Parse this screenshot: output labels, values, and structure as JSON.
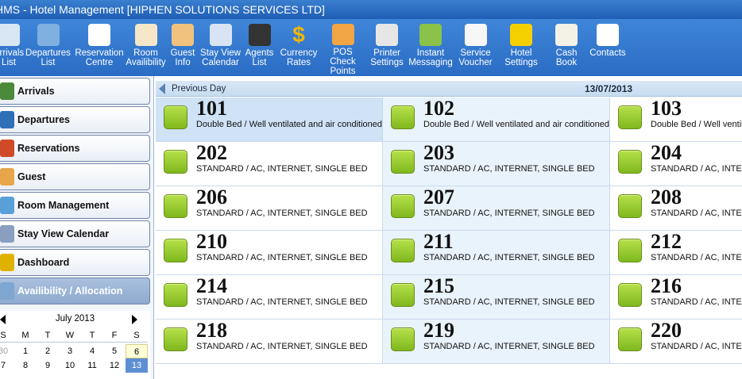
{
  "window": {
    "title": "HMS - Hotel Management [HIPHEN SOLUTIONS SERVICES LTD]"
  },
  "toolbar": {
    "items": [
      {
        "label": "Arrivals\nList",
        "icon": "arrivals-icon",
        "color": "#d9e6f3"
      },
      {
        "label": "Departures\nList",
        "icon": "departures-icon",
        "color": "#7fb0e0"
      },
      {
        "label": "Reservation\nCentre",
        "icon": "reservation-icon",
        "color": "#ffffff"
      },
      {
        "label": "Room\nAvailibility",
        "icon": "room-icon",
        "color": "#f5e6c8"
      },
      {
        "label": "Guest\nInfo",
        "icon": "guest-icon",
        "color": "#f1c27d"
      },
      {
        "label": "Stay View\nCalendar",
        "icon": "calendar-icon",
        "color": "#d8e4f3"
      },
      {
        "label": "Agents\nList",
        "icon": "agent-icon",
        "color": "#333333"
      },
      {
        "label": "Currency\nRates",
        "icon": "dollar-icon",
        "color": "#f0b800"
      },
      {
        "label": "POS Check\nPoints",
        "icon": "pos-icon",
        "color": "#f2a544"
      },
      {
        "label": "Printer\nSettings",
        "icon": "printer-icon",
        "color": "#e6e6e6"
      },
      {
        "label": "Instant\nMessaging",
        "icon": "chat-icon",
        "color": "#8bc34a"
      },
      {
        "label": "Service\nVoucher",
        "icon": "voucher-icon",
        "color": "#f7f7f7"
      },
      {
        "label": "Hotel\nSettings",
        "icon": "tools-icon",
        "color": "#f5d000"
      },
      {
        "label": "Cash Book",
        "icon": "book-icon",
        "color": "#f4f1e6"
      },
      {
        "label": "Contacts",
        "icon": "contacts-icon",
        "color": "#ffffff"
      }
    ]
  },
  "sidebar": {
    "items": [
      {
        "label": "Arrivals",
        "icon": "arrivals-icon"
      },
      {
        "label": "Departures",
        "icon": "departures-icon"
      },
      {
        "label": "Reservations",
        "icon": "reservations-icon"
      },
      {
        "label": "Guest",
        "icon": "guest-icon"
      },
      {
        "label": "Room Management",
        "icon": "room-management-icon"
      },
      {
        "label": "Stay View Calendar",
        "icon": "calendar-icon"
      },
      {
        "label": "Dashboard",
        "icon": "dashboard-icon"
      },
      {
        "label": "Availibility / Allocation",
        "icon": "availability-icon",
        "active": true
      }
    ]
  },
  "calendar": {
    "month": "July 2013",
    "days_of_week": [
      "S",
      "M",
      "T",
      "W",
      "T",
      "F",
      "S"
    ],
    "weeks": [
      [
        "30",
        "1",
        "2",
        "3",
        "4",
        "5",
        "6"
      ],
      [
        "7",
        "8",
        "9",
        "10",
        "11",
        "12",
        "13"
      ]
    ],
    "selected": "13",
    "highlight": "6"
  },
  "main": {
    "previous_day_label": "Previous Day",
    "date": "13/07/2013",
    "room_status_color": "#8cc63f",
    "rooms": [
      {
        "number": "101",
        "desc": "Double Bed  / Well ventilated and air conditioned"
      },
      {
        "number": "102",
        "desc": "Double Bed  / Well ventilated and air conditioned"
      },
      {
        "number": "103",
        "desc": "Double Bed  / Well ventilated and air conditioned"
      },
      {
        "number": "202",
        "desc": "STANDARD / AC, INTERNET, SINGLE BED"
      },
      {
        "number": "203",
        "desc": "STANDARD / AC, INTERNET, SINGLE BED"
      },
      {
        "number": "204",
        "desc": "STANDARD / AC, INTERNET, SINGLE BED"
      },
      {
        "number": "206",
        "desc": "STANDARD / AC, INTERNET, SINGLE BED"
      },
      {
        "number": "207",
        "desc": "STANDARD / AC, INTERNET, SINGLE BED"
      },
      {
        "number": "208",
        "desc": "STANDARD / AC, INTERNET, SINGLE BED"
      },
      {
        "number": "210",
        "desc": "STANDARD / AC, INTERNET, SINGLE BED"
      },
      {
        "number": "211",
        "desc": "STANDARD / AC, INTERNET, SINGLE BED"
      },
      {
        "number": "212",
        "desc": "STANDARD / AC, INTERNET, SINGLE BED"
      },
      {
        "number": "214",
        "desc": "STANDARD / AC, INTERNET, SINGLE BED"
      },
      {
        "number": "215",
        "desc": "STANDARD / AC, INTERNET, SINGLE BED"
      },
      {
        "number": "216",
        "desc": "STANDARD / AC, INTERNET, SINGLE BED"
      },
      {
        "number": "218",
        "desc": "STANDARD / AC, INTERNET, SINGLE BED"
      },
      {
        "number": "219",
        "desc": "STANDARD / AC, INTERNET, SINGLE BED"
      },
      {
        "number": "220",
        "desc": "STANDARD / AC, INTERNET, SINGLE BED"
      }
    ]
  }
}
